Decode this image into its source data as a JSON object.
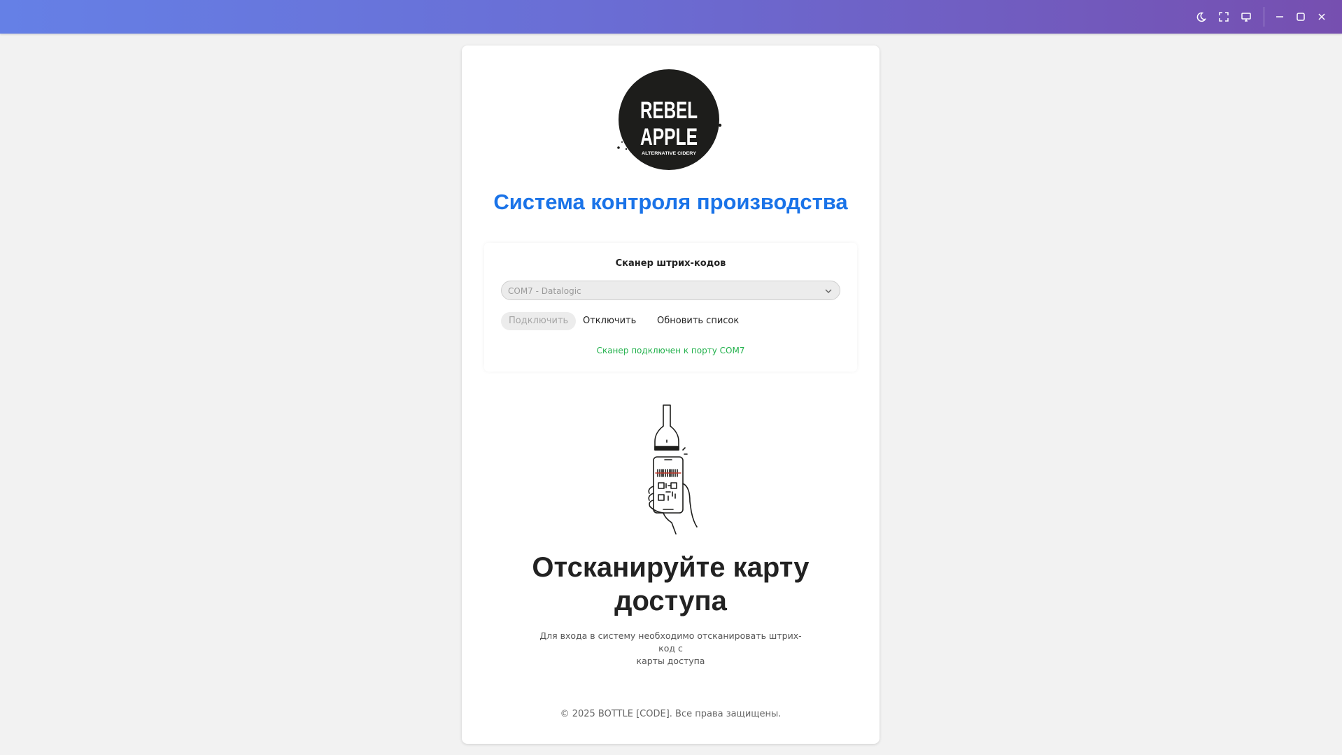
{
  "window": {
    "controls": [
      "night-mode-icon",
      "fullscreen-icon",
      "monitor-icon",
      "minimize-icon",
      "maximize-icon",
      "close-icon"
    ]
  },
  "logo": {
    "line1": "REBEL",
    "line2": "APPLE",
    "tagline": "ALTERNATIVE CIDERY"
  },
  "page": {
    "title": "Система контроля производства"
  },
  "scanner": {
    "title": "Сканер штрих-кодов",
    "selected_port": "COM7 - Datalogic",
    "connect_label": "Подключить",
    "disconnect_label": "Отключить",
    "refresh_label": "Обновить список",
    "status": "Сканер подключен к порту COM7"
  },
  "prompt": {
    "heading_line1": "Отсканируйте карту",
    "heading_line2": "доступа",
    "subtitle_line1": "Для входа в систему необходимо отсканировать штрих-код с",
    "subtitle_line2": "карты доступа"
  },
  "footer": {
    "copyright": "© 2025 BOTTLE [CODE]. Все права защищены."
  },
  "colors": {
    "accent": "#1a73e8",
    "success": "#22b14c",
    "titlebar_start": "#6580e6",
    "titlebar_end": "#764fb0"
  }
}
